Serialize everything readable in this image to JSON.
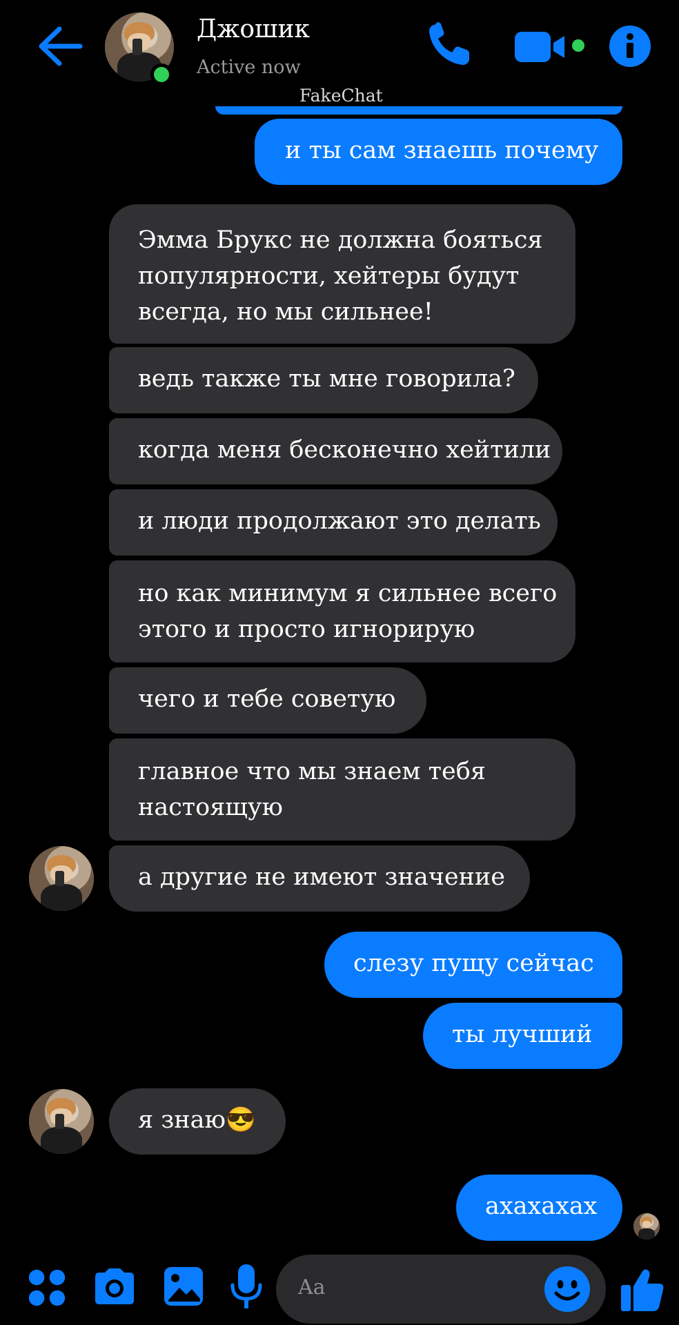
{
  "header": {
    "contact_name": "Джошик",
    "status": "Active now",
    "watermark": "FakeChat"
  },
  "messages": [
    {
      "dir": "out",
      "text": "и ты сам знаешь почему"
    },
    {
      "dir": "in",
      "text": "Эмма Брукс не должна бояться популярности, хейтеры будут всегда, но мы сильнее!"
    },
    {
      "dir": "in",
      "text": "ведь также ты мне говорила?"
    },
    {
      "dir": "in",
      "text": "когда меня бесконечно хейтили"
    },
    {
      "dir": "in",
      "text": "и люди продолжают это делать"
    },
    {
      "dir": "in",
      "text": "но как минимум я сильнее всего этого и просто игнорирую"
    },
    {
      "dir": "in",
      "text": "чего и тебе советую"
    },
    {
      "dir": "in",
      "text": "главное что мы знаем тебя настоящую"
    },
    {
      "dir": "in",
      "text": "а другие не имеют значение"
    },
    {
      "dir": "out",
      "text": "слезу пущу сейчас"
    },
    {
      "dir": "out",
      "text": "ты лучший"
    },
    {
      "dir": "in",
      "text": "я знаю😎"
    },
    {
      "dir": "out",
      "text": "ахахахах"
    }
  ],
  "composer": {
    "placeholder": "Aa"
  },
  "icons": {
    "back": "arrow-left-icon",
    "call": "phone-icon",
    "video": "video-camera-icon",
    "info": "info-icon",
    "apps": "four-dots-icon",
    "camera": "camera-icon",
    "gallery": "image-icon",
    "mic": "microphone-icon",
    "emoji": "smiley-icon",
    "like": "thumbs-up-icon"
  },
  "colors": {
    "accent": "#0a7cff",
    "incoming_bubble": "#313033",
    "background": "#000000",
    "online": "#31d158"
  }
}
